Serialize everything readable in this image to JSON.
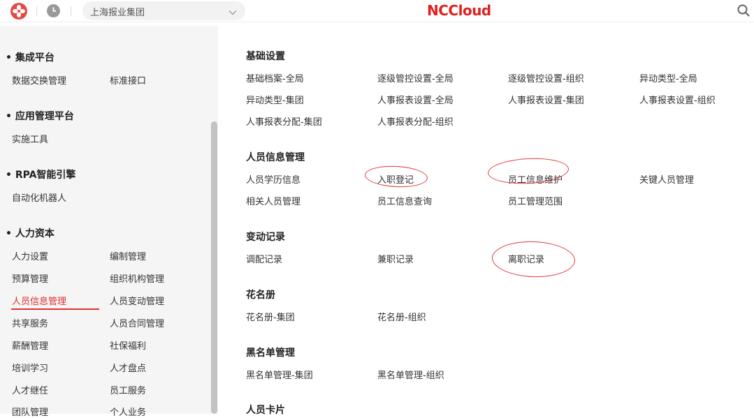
{
  "topbar": {
    "org": "上海报业集团",
    "brand": "NCCloud"
  },
  "sidebar": {
    "groups": [
      {
        "title": "集成平台",
        "items": [
          "数据交换管理",
          "标准接口"
        ]
      },
      {
        "title": "应用管理平台",
        "items": [
          "实施工具"
        ]
      },
      {
        "title": "RPA智能引擎",
        "items": [
          "自动化机器人"
        ]
      },
      {
        "title": "人力资本",
        "items": [
          "人力设置",
          "编制管理",
          "预算管理",
          "组织机构管理",
          "人员信息管理",
          "人员变动管理",
          "共享服务",
          "人员合同管理",
          "薪酬管理",
          "社保福利",
          "培训学习",
          "人才盘点",
          "人才继任",
          "员工服务",
          "团队管理",
          "个人业务"
        ]
      }
    ],
    "active_item": "人员信息管理"
  },
  "main": {
    "sections": [
      {
        "title": "基础设置",
        "items": [
          "基础档案-全局",
          "逐级管控设置-全局",
          "逐级管控设置-组织",
          "异动类型-全局",
          "异动类型-集团",
          "人事报表设置-全局",
          "人事报表设置-集团",
          "人事报表设置-组织",
          "人事报表分配-集团",
          "人事报表分配-组织"
        ]
      },
      {
        "title": "人员信息管理",
        "items": [
          "人员学历信息",
          "入职登记",
          "员工信息维护",
          "关键人员管理",
          "相关人员管理",
          "员工信息查询",
          "员工管理范围"
        ]
      },
      {
        "title": "变动记录",
        "items": [
          "调配记录",
          "兼职记录",
          "离职记录"
        ]
      },
      {
        "title": "花名册",
        "items": [
          "花名册-集团",
          "花名册-组织"
        ]
      },
      {
        "title": "黑名单管理",
        "items": [
          "黑名单管理-集团",
          "黑名单管理-组织"
        ]
      },
      {
        "title": "人员卡片",
        "items": []
      }
    ],
    "circled_items": [
      "入职登记",
      "员工信息维护",
      "离职记录"
    ]
  },
  "colors": {
    "brand_red": "#e02020",
    "active_red": "#e03030",
    "annotation_red": "#e23a3a",
    "sidebar_bg": "#f5f5f5"
  },
  "icons": [
    "app-logo-icon",
    "clock-icon",
    "chevron-down-icon",
    "search-icon"
  ]
}
